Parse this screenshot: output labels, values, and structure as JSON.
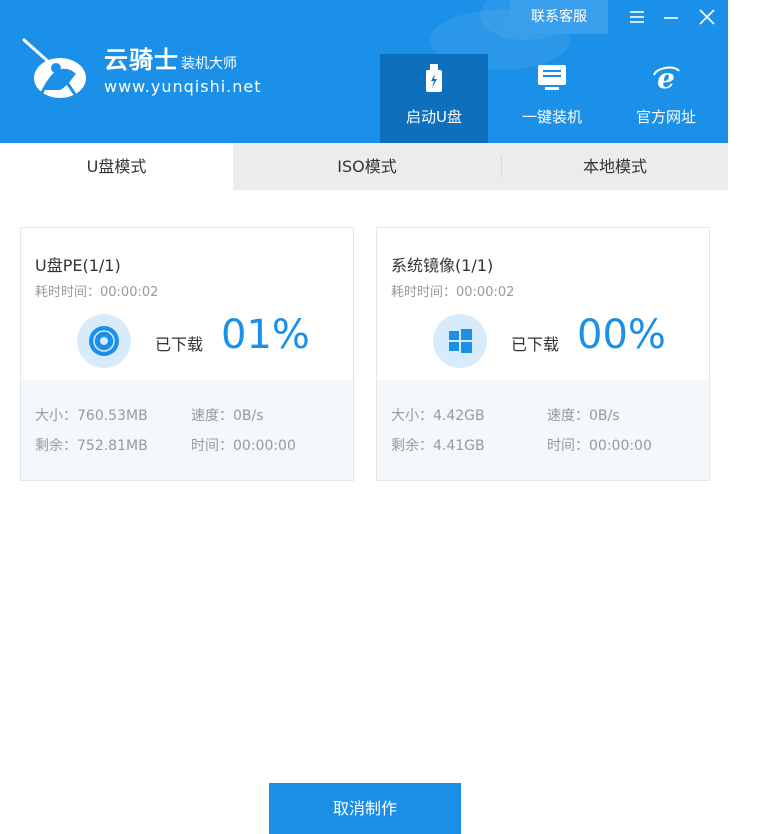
{
  "brand": {
    "name": "云骑士",
    "subtitle": "装机大师",
    "url": "www.yunqishi.net"
  },
  "header": {
    "service_button": "联系客服",
    "nav": [
      {
        "label": "启动U盘",
        "icon": "usb-drive-icon",
        "active": true
      },
      {
        "label": "一键装机",
        "icon": "monitor-icon",
        "active": false
      },
      {
        "label": "官方网址",
        "icon": "ie-browser-icon",
        "active": false
      }
    ]
  },
  "tabs": [
    {
      "label": "U盘模式",
      "active": true
    },
    {
      "label": "ISO模式",
      "active": false
    },
    {
      "label": "本地模式",
      "active": false
    }
  ],
  "cards": [
    {
      "title": "U盘PE(1/1)",
      "elapsed": "耗时时间：00:00:02",
      "icon": "disc-icon",
      "downloaded_label": "已下载",
      "percent": "01%",
      "size": "大小：760.53MB",
      "speed": "速度：0B/s",
      "remaining": "剩余：752.81MB",
      "time": "时间：00:00:00"
    },
    {
      "title": "系统镜像(1/1)",
      "elapsed": "耗时时间：00:00:02",
      "icon": "windows-logo-icon",
      "downloaded_label": "已下载",
      "percent": "00%",
      "size": "大小：4.42GB",
      "speed": "速度：0B/s",
      "remaining": "剩余：4.41GB",
      "time": "时间：00:00:00"
    }
  ],
  "cancel_button": "取消制作",
  "colors": {
    "primary": "#1b90e8",
    "nav_active": "#0e6fbd",
    "tab_bar": "#ececec",
    "card_footer": "#f5f8fb"
  }
}
